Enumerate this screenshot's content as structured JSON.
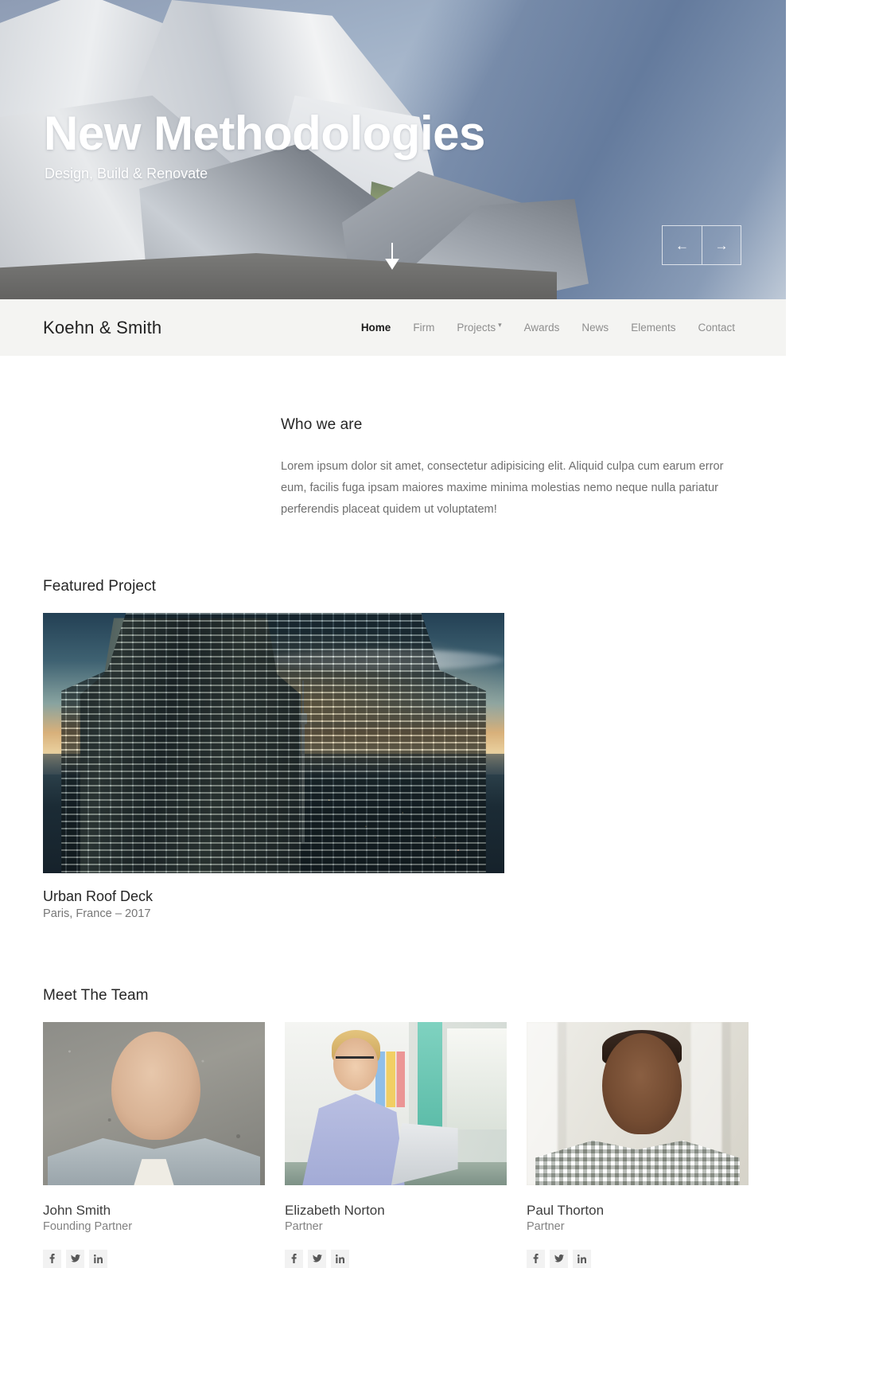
{
  "hero": {
    "title": "New Methodologies",
    "subtitle": "Design, Build & Renovate",
    "scroll_icon": "arrow-down-icon",
    "prev_label": "←",
    "next_label": "→"
  },
  "header": {
    "brand": "Koehn & Smith",
    "nav": [
      {
        "label": "Home",
        "active": true,
        "has_caret": false
      },
      {
        "label": "Firm",
        "active": false,
        "has_caret": false
      },
      {
        "label": "Projects",
        "active": false,
        "has_caret": true
      },
      {
        "label": "Awards",
        "active": false,
        "has_caret": false
      },
      {
        "label": "News",
        "active": false,
        "has_caret": false
      },
      {
        "label": "Elements",
        "active": false,
        "has_caret": false
      },
      {
        "label": "Contact",
        "active": false,
        "has_caret": false
      }
    ]
  },
  "about": {
    "heading": "Who we are",
    "body": "Lorem ipsum dolor sit amet, consectetur adipisicing elit. Aliquid culpa cum earum error eum, facilis fuga ipsam maiores maxime minima molestias nemo neque nulla pariatur perferendis placeat quidem ut voluptatem!"
  },
  "featured": {
    "heading": "Featured Project",
    "project_title": "Urban Roof Deck",
    "project_meta": "Paris, France – 2017"
  },
  "team": {
    "heading": "Meet The Team",
    "members": [
      {
        "name": "John Smith",
        "role": "Founding Partner"
      },
      {
        "name": "Elizabeth Norton",
        "role": "Partner"
      },
      {
        "name": "Paul Thorton",
        "role": "Partner"
      }
    ],
    "social": [
      {
        "id": "facebook-icon",
        "label": "f"
      },
      {
        "id": "twitter-icon",
        "label": "t"
      },
      {
        "id": "linkedin-icon",
        "label": "in"
      }
    ]
  },
  "colors": {
    "header_bg": "#f4f4f2",
    "nav_active": "#1d1d1d",
    "nav_inactive": "#8e8e8e",
    "heading": "#262626",
    "body_text": "#6e6e6e",
    "social_bg": "#f2f2f2"
  }
}
